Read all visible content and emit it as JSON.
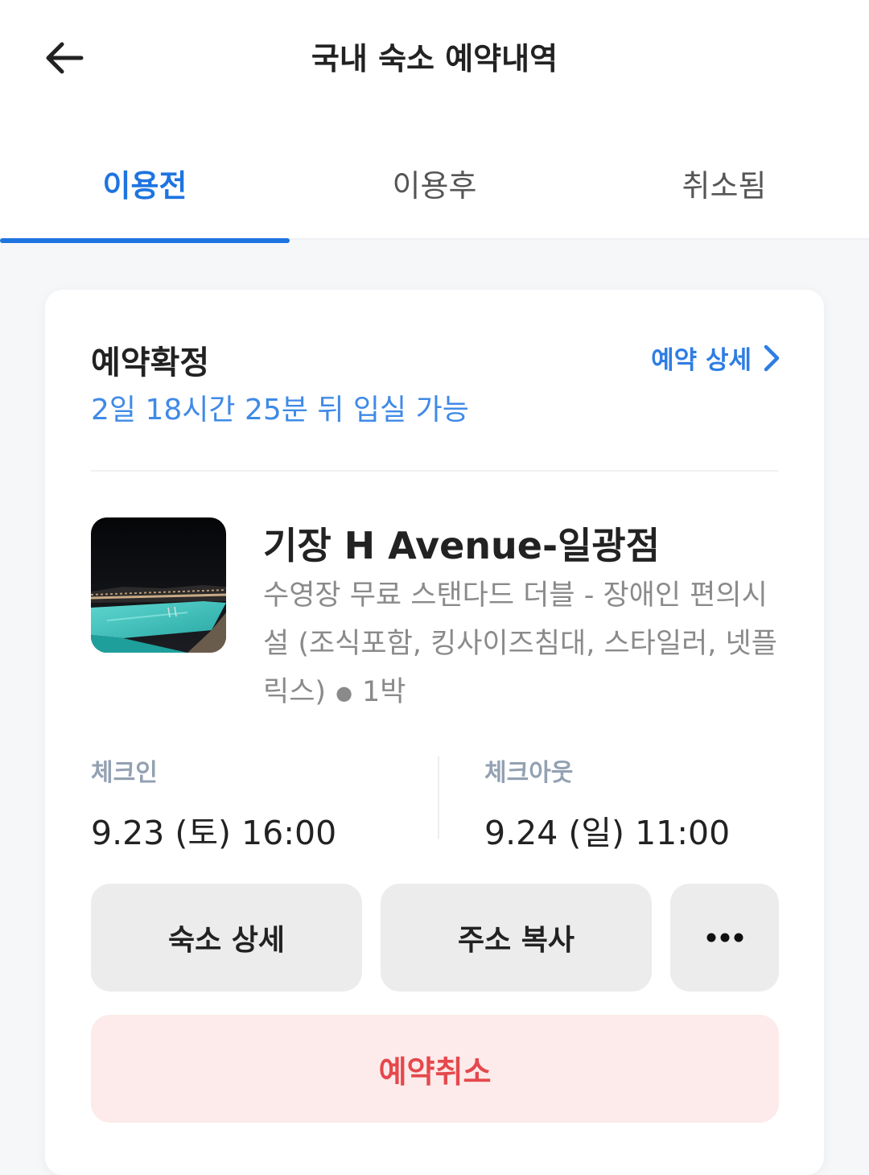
{
  "header": {
    "title": "국내 숙소 예약내역",
    "back_icon": "arrow-left-icon"
  },
  "tabs": [
    {
      "label": "이용전",
      "active": true
    },
    {
      "label": "이용후",
      "active": false
    },
    {
      "label": "취소됨",
      "active": false
    }
  ],
  "booking": {
    "status": "예약확정",
    "detail_link": "예약 상세",
    "countdown": "2일 18시간 25분 뒤 입실 가능",
    "hotel_name": "기장 H Avenue-일광점",
    "room_desc": "수영장 무료 스탠다드 더블 - 장애인 편의시설 (조식포함, 킹사이즈침대, 스타일러, 넷플릭스)",
    "nights": "1박",
    "checkin": {
      "label": "체크인",
      "value": "9.23 (토) 16:00"
    },
    "checkout": {
      "label": "체크아웃",
      "value": "9.24 (일) 11:00"
    },
    "buttons": {
      "hotel_detail": "숙소 상세",
      "copy_address": "주소 복사",
      "more_icon": "more-horizontal-icon"
    },
    "cancel": "예약취소"
  },
  "colors": {
    "accent": "#1e74e0",
    "link": "#2e7de4",
    "danger": "#e5484d",
    "danger_bg": "#fcebea"
  }
}
